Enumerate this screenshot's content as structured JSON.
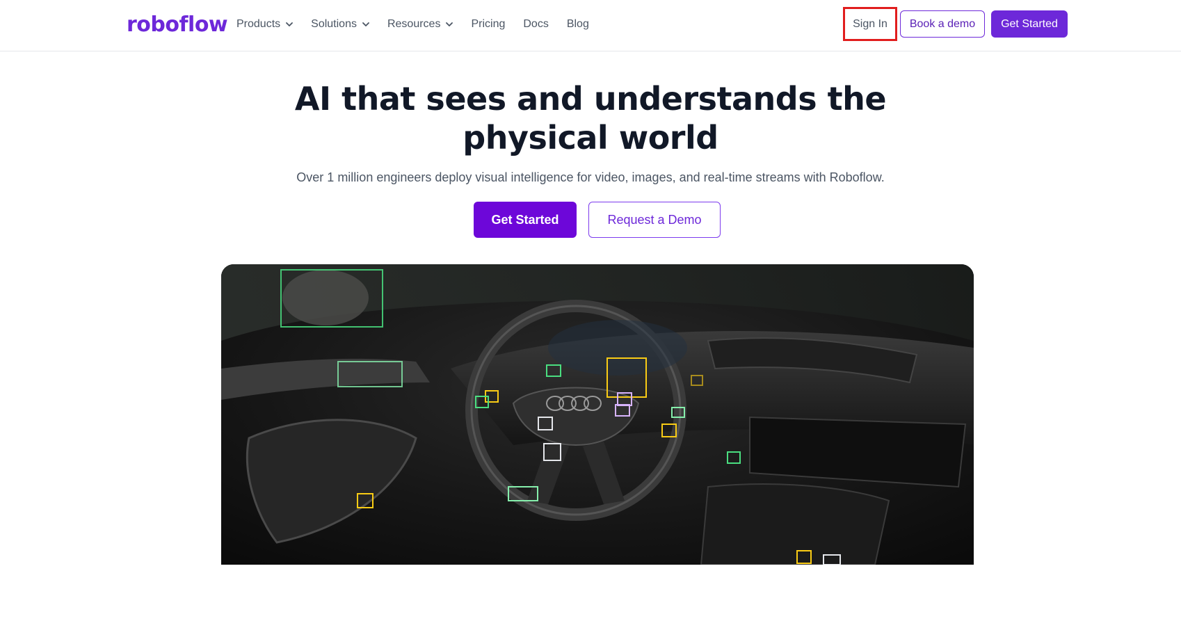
{
  "header": {
    "logo": "roboflow",
    "nav": [
      {
        "label": "Products",
        "dropdown": true
      },
      {
        "label": "Solutions",
        "dropdown": true
      },
      {
        "label": "Resources",
        "dropdown": true
      },
      {
        "label": "Pricing",
        "dropdown": false
      },
      {
        "label": "Docs",
        "dropdown": false
      },
      {
        "label": "Blog",
        "dropdown": false
      }
    ],
    "sign_in": "Sign In",
    "book_demo": "Book a demo",
    "get_started": "Get Started"
  },
  "hero": {
    "title_line1": "AI that sees and understands the",
    "title_line2": "physical world",
    "subtitle": "Over 1 million engineers deploy visual intelligence for video, images, and real-time streams with Roboflow.",
    "primary_cta": "Get Started",
    "secondary_cta": "Request a Demo"
  },
  "colors": {
    "brand": "#6d28d9",
    "highlight": "#e11d1d"
  }
}
